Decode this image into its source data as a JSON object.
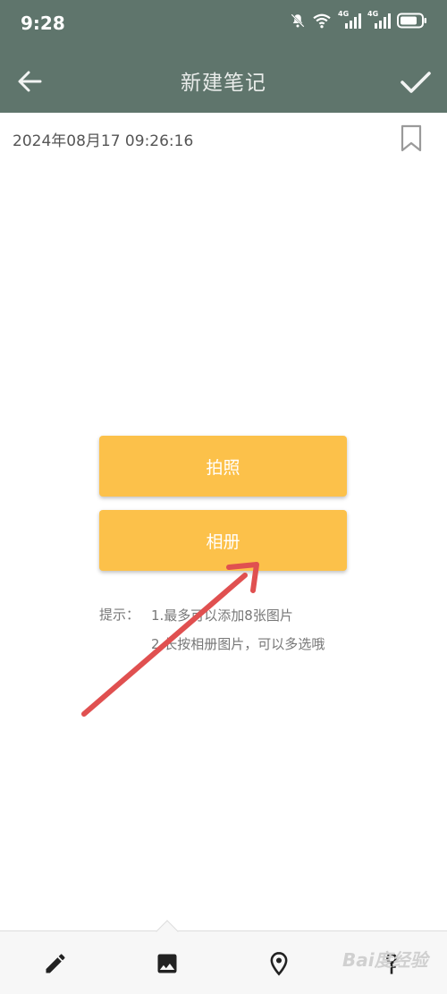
{
  "status_bar": {
    "time": "9:28",
    "net_label_1": "4G",
    "net_label_2": "4G"
  },
  "app_bar": {
    "title": "新建笔记",
    "back_icon": "arrow-left-icon",
    "confirm_icon": "check-icon"
  },
  "note": {
    "datetime": "2024年08月17 09:26:16",
    "bookmark_icon": "bookmark-icon"
  },
  "buttons": {
    "camera": "拍照",
    "album": "相册"
  },
  "tips": {
    "label": "提示：",
    "line1": "1.最多可以添加8张图片",
    "line2": "2.长按相册图片，可以多选哦"
  },
  "bottom_tabs": [
    {
      "name": "edit",
      "icon": "pencil-icon"
    },
    {
      "name": "image",
      "icon": "image-icon",
      "selected": true
    },
    {
      "name": "location",
      "icon": "location-pin-icon"
    },
    {
      "name": "person",
      "icon": "person-icon"
    }
  ],
  "watermark": "Bai度经验",
  "colors": {
    "header": "#5f756c",
    "button": "#fcc14a",
    "annotation_arrow": "#e05050"
  }
}
